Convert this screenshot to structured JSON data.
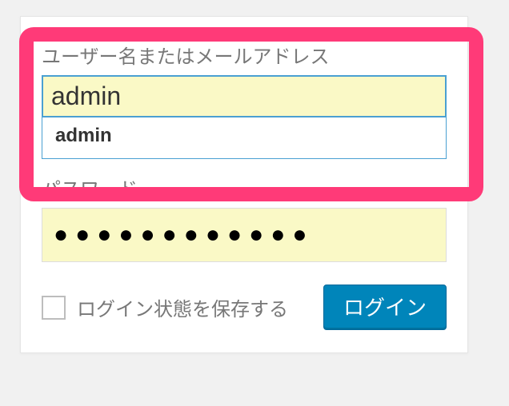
{
  "login": {
    "username_label": "ユーザー名またはメールアドレス",
    "username_value": "admin",
    "autocomplete_item": "admin",
    "password_label": "パスワード",
    "password_masked": "●●●●●●●●●●●●",
    "remember_label": "ログイン状態を保存する",
    "submit_label": "ログイン"
  }
}
